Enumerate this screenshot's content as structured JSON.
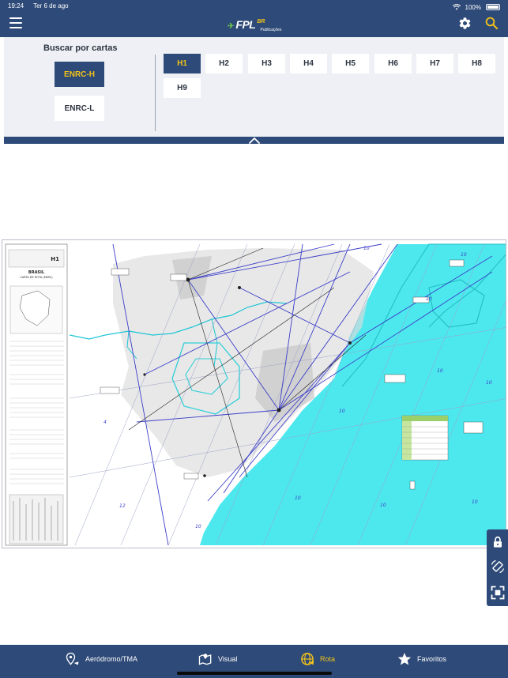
{
  "status_bar": {
    "time": "19:24",
    "date": "Ter 6 de ago",
    "battery": "100%"
  },
  "header": {
    "logo_name": "FPL",
    "logo_suffix": "BR",
    "logo_sub": "Publicações"
  },
  "search_panel": {
    "title": "Buscar por cartas",
    "chart_types": [
      {
        "label": "ENRC-H",
        "active": true
      },
      {
        "label": "ENRC-L",
        "active": false
      }
    ],
    "charts": [
      {
        "label": "H1",
        "active": true
      },
      {
        "label": "H2",
        "active": false
      },
      {
        "label": "H3",
        "active": false
      },
      {
        "label": "H4",
        "active": false
      },
      {
        "label": "H5",
        "active": false
      },
      {
        "label": "H6",
        "active": false
      },
      {
        "label": "H7",
        "active": false
      },
      {
        "label": "H8",
        "active": false
      },
      {
        "label": "H9",
        "active": false
      }
    ]
  },
  "map_labels": {
    "country": "BRASIL",
    "chart_title": "CARTA DE ROTA (ENRC)",
    "chart_code": "H1"
  },
  "side_tools": [
    {
      "icon": "lock-icon"
    },
    {
      "icon": "rotate-icon"
    },
    {
      "icon": "fullscreen-icon"
    }
  ],
  "bottom_nav": [
    {
      "label": "Aeródromo/TMA",
      "icon": "aerodrome-pin-icon",
      "active": false
    },
    {
      "label": "Visual",
      "icon": "visual-map-icon",
      "active": false
    },
    {
      "label": "Rota",
      "icon": "globe-route-icon",
      "active": true
    },
    {
      "label": "Favoritos",
      "icon": "star-icon",
      "active": false
    }
  ],
  "colors": {
    "primary": "#2e4a78",
    "accent": "#f2c318",
    "sea": "#4de8ee",
    "route": "#3c3fc8"
  }
}
